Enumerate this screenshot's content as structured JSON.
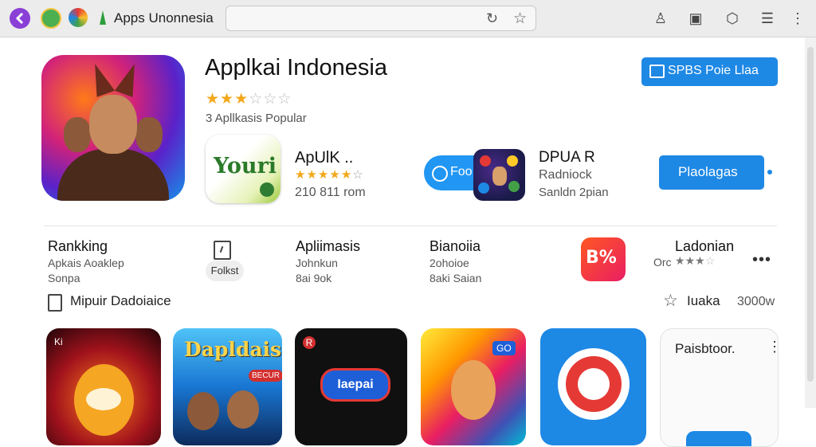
{
  "browser": {
    "tab_title": "Apps Unonnesia",
    "url": "",
    "accent": "#8a3fd6"
  },
  "hero": {
    "title": "Applkai Indonesia",
    "rating": 3,
    "rating_max": 5,
    "subtitle": "3 Apllkasis Popular",
    "primary_button": "SPBS Poie Llaa"
  },
  "featured": [
    {
      "title": "ApUlK ..",
      "stars": "★★★★★☆",
      "meta": "210 811 rom",
      "icon": "youri-icon",
      "icon_text": "Youri"
    },
    {
      "pill_label": "Foo",
      "title": "DPUA R",
      "line2": "Radniock",
      "line3": "Sanldn 2pian",
      "icon": "game-icon"
    }
  ],
  "secondary_button": "Plaolagas",
  "sections": [
    {
      "title": "Rankking",
      "line1": "Apkais Aoaklep",
      "line2": "Sonpa"
    },
    {
      "button": "Folkst"
    },
    {
      "title": "Apliimasis",
      "line1": "Johnkun",
      "line2": "8ai 9ok"
    },
    {
      "title": "Bianoiia",
      "line1": "2ohoioe",
      "line2": "8aki Saian"
    },
    {
      "icon_text": "B%",
      "title": "Ladonian",
      "prefix": "Orc",
      "stars_on": 3,
      "stars_off": 1
    }
  ],
  "row_label": "Mipuir Dadoiaice",
  "right_label": "Iuaka",
  "right_count": "3000w",
  "tiles": [
    {
      "badge": "Ki"
    },
    {
      "title": "Dapldais",
      "badge": "BECUR"
    },
    {
      "badge": "R",
      "label": "Iaepai"
    },
    {
      "badge": "GO"
    },
    {},
    {
      "title": "Paisbtoor."
    }
  ]
}
